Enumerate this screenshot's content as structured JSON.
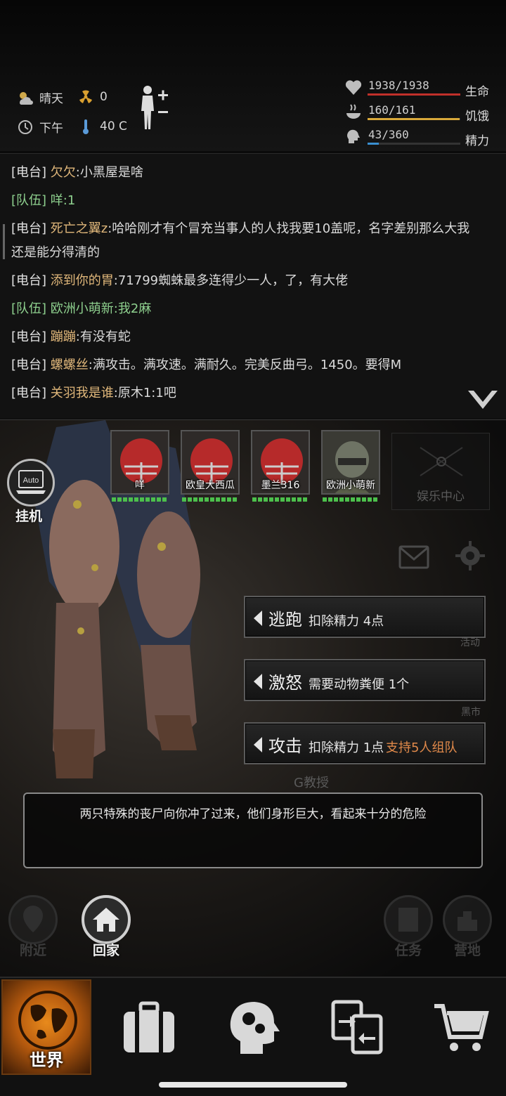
{
  "status": {
    "weather": "晴天",
    "radiation": "0",
    "time_of_day": "下午",
    "temperature": "40 C"
  },
  "vitals": [
    {
      "value": "1938/1938",
      "name": "生命",
      "fraction": 1.0,
      "color": "#c0302a"
    },
    {
      "value": "160/161",
      "name": "饥饿",
      "fraction": 0.99,
      "color": "#d9a93a"
    },
    {
      "value": "43/360",
      "name": "精力",
      "fraction": 0.12,
      "color": "#3a8fd0"
    }
  ],
  "chat": [
    {
      "channel": "[电台]",
      "sender": "欠欠",
      "text": ":小黑屋是啥",
      "type": "radio"
    },
    {
      "channel": "[队伍]",
      "sender": "咩",
      "text": ":1",
      "type": "team"
    },
    {
      "channel": "[电台]",
      "sender": "死亡之翼z",
      "text": ":哈哈刚才有个冒充当事人的人找我要10盖呢，名字差别那么大我",
      "text2": "还是能分得清的",
      "type": "radio"
    },
    {
      "channel": "[电台]",
      "sender": "添到你的胃",
      "text": ":71799蜘蛛最多连得少一人，了，有大佬",
      "type": "radio"
    },
    {
      "channel": "[队伍]",
      "sender": "欧洲小萌新",
      "text": ":我2麻",
      "type": "team"
    },
    {
      "channel": "[电台]",
      "sender": "蹦蹦",
      "text": ":有没有蛇",
      "type": "radio"
    },
    {
      "channel": "[电台]",
      "sender": "螺螺丝",
      "text": ":满攻击。满攻速。满耐久。完美反曲弓。1450。要得M",
      "type": "radio"
    },
    {
      "channel": "[电台]",
      "sender": "关羽我是谁",
      "text": ":原木1:1吧",
      "type": "radio"
    }
  ],
  "auto": {
    "icon_text": "Auto",
    "label": "挂机"
  },
  "party": [
    {
      "name": "咩",
      "hp": 1.0
    },
    {
      "name": "欧皇大西瓜",
      "hp": 1.0
    },
    {
      "name": "墨兰316",
      "hp": 1.0
    },
    {
      "name": "欧洲小萌新",
      "hp": 1.0
    }
  ],
  "entertainment_center": "娱乐中心",
  "background_labels": {
    "activity": "活动",
    "black_market": "黑市",
    "professor": "G教授"
  },
  "actions": [
    {
      "name": "逃跑",
      "desc": "扣除精力 4点",
      "extra": ""
    },
    {
      "name": "激怒",
      "desc": "需要动物粪便 1个",
      "extra": ""
    },
    {
      "name": "攻击",
      "desc": "扣除精力 1点",
      "extra": "支持5人组队"
    }
  ],
  "message": "两只特殊的丧尸向你冲了过来，他们身形巨大，看起来十分的危险",
  "map_buttons": {
    "nearby": "附近",
    "home": "回家",
    "tasks": "任务",
    "camp": "营地"
  },
  "nav": {
    "world": "世界"
  }
}
